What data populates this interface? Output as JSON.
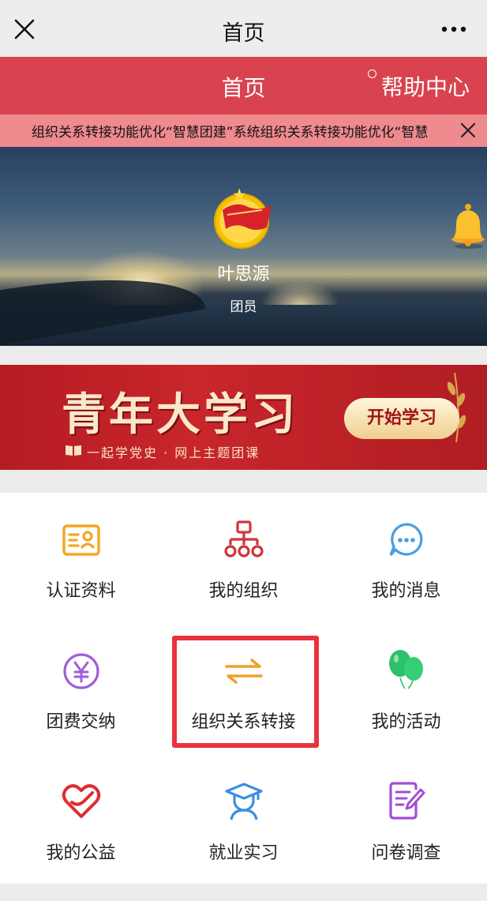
{
  "wechat_bar": {
    "title": "首页",
    "close_icon": "close-icon",
    "more_icon": "more-icon"
  },
  "header": {
    "title": "首页",
    "help_label": "帮助中心"
  },
  "notice": {
    "text": "组织关系转接功能优化“智慧团建”系统组织关系转接功能优化“智慧"
  },
  "profile": {
    "name": "叶思源",
    "role": "团员"
  },
  "study_banner": {
    "title": "青年大学习",
    "subtitle": "一起学党史 · 网上主题团课",
    "button_label": "开始学习"
  },
  "grid": [
    {
      "label": "认证资料",
      "icon": "id-card-icon",
      "color": "#f5a623"
    },
    {
      "label": "我的组织",
      "icon": "org-chart-icon",
      "color": "#d0343d"
    },
    {
      "label": "我的消息",
      "icon": "chat-bubble-icon",
      "color": "#4a9ee0"
    },
    {
      "label": "团费交纳",
      "icon": "yen-coin-icon",
      "color": "#a05fd8"
    },
    {
      "label": "组织关系转接",
      "icon": "transfer-arrows-icon",
      "color": "#f0a02a"
    },
    {
      "label": "我的活动",
      "icon": "balloons-icon",
      "color": "#2cc06a"
    },
    {
      "label": "我的公益",
      "icon": "heart-hand-icon",
      "color": "#e02b33"
    },
    {
      "label": "就业实习",
      "icon": "graduate-icon",
      "color": "#3c8ee0"
    },
    {
      "label": "问卷调查",
      "icon": "survey-pen-icon",
      "color": "#a24fd6"
    }
  ],
  "colors": {
    "header_red": "#d9434f",
    "notice_pink": "#ef8a8f",
    "highlight_red": "#e8333c"
  }
}
